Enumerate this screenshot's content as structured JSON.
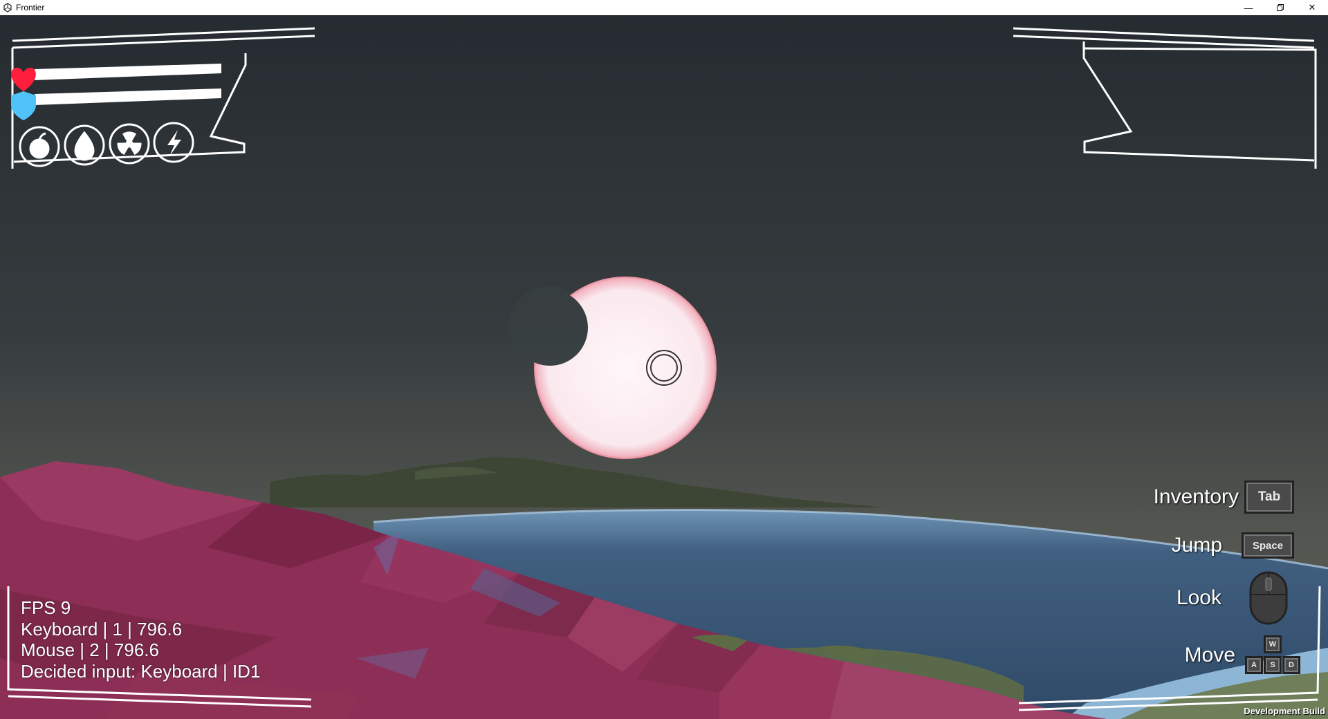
{
  "window": {
    "title": "Frontier",
    "controls": [
      "minimize-icon",
      "restore-icon",
      "close-icon"
    ]
  },
  "status_bars": {
    "health": {
      "icon": "heart-icon",
      "color": "#ff1e3c",
      "fill": 1.0
    },
    "shield": {
      "icon": "shield-icon",
      "color": "#4fc3f7",
      "fill": 1.0
    }
  },
  "status_icons": [
    "food-icon",
    "water-icon",
    "radiation-icon",
    "energy-icon"
  ],
  "debug": {
    "fps": "FPS 9",
    "keyboard": "Keyboard | 1 | 796.6",
    "mouse": "Mouse | 2 | 796.6",
    "decided": "Decided input: Keyboard | ID1"
  },
  "controls": {
    "inventory": {
      "label": "Inventory",
      "key": "Tab"
    },
    "jump": {
      "label": "Jump",
      "key": "Space"
    },
    "look": {
      "label": "Look",
      "icon": "mouse-icon"
    },
    "move": {
      "label": "Move",
      "keys": [
        "W",
        "A",
        "S",
        "D"
      ]
    }
  },
  "footer": {
    "dev_build": "Development Build"
  },
  "colors": {
    "terrain": "#8a2d52",
    "water": "#3d5a7a",
    "moon": "#fbeff2",
    "sky_top": "#272d31",
    "sky_bottom": "#5c5e55"
  }
}
